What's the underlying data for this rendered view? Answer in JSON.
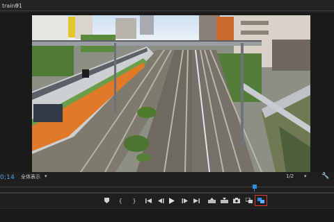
{
  "panel": {
    "title": "train01",
    "menu_icon": "hamburger-icon"
  },
  "viewer": {
    "frame_description_icon": "video-frame"
  },
  "status": {
    "timecode": "0;14",
    "zoom_value": "全体表示",
    "resolution_value": "1/2"
  },
  "playback": {
    "position": 0.765
  },
  "controls": [
    "add-marker-icon",
    "mark-in-icon",
    "mark-out-icon",
    "go-to-in-icon",
    "step-back-icon",
    "play-icon",
    "step-forward-icon",
    "go-to-out-icon",
    "insert-icon",
    "overwrite-icon",
    "export-frame-icon",
    "comparison-view-icon",
    "proxy-toggle-icon"
  ],
  "colors": {
    "accent": "#2e8be6",
    "timecode": "#4aa3e8",
    "highlight": "#e23b2e"
  }
}
